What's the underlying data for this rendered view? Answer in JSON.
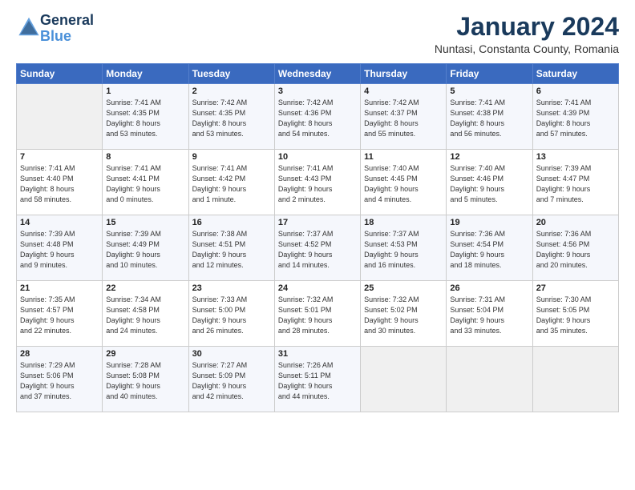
{
  "header": {
    "logo_line1": "General",
    "logo_line2": "Blue",
    "month": "January 2024",
    "location": "Nuntasi, Constanta County, Romania"
  },
  "days_of_week": [
    "Sunday",
    "Monday",
    "Tuesday",
    "Wednesday",
    "Thursday",
    "Friday",
    "Saturday"
  ],
  "weeks": [
    [
      {
        "day": "",
        "info": ""
      },
      {
        "day": "1",
        "info": "Sunrise: 7:41 AM\nSunset: 4:35 PM\nDaylight: 8 hours\nand 53 minutes."
      },
      {
        "day": "2",
        "info": "Sunrise: 7:42 AM\nSunset: 4:35 PM\nDaylight: 8 hours\nand 53 minutes."
      },
      {
        "day": "3",
        "info": "Sunrise: 7:42 AM\nSunset: 4:36 PM\nDaylight: 8 hours\nand 54 minutes."
      },
      {
        "day": "4",
        "info": "Sunrise: 7:42 AM\nSunset: 4:37 PM\nDaylight: 8 hours\nand 55 minutes."
      },
      {
        "day": "5",
        "info": "Sunrise: 7:41 AM\nSunset: 4:38 PM\nDaylight: 8 hours\nand 56 minutes."
      },
      {
        "day": "6",
        "info": "Sunrise: 7:41 AM\nSunset: 4:39 PM\nDaylight: 8 hours\nand 57 minutes."
      }
    ],
    [
      {
        "day": "7",
        "info": "Sunrise: 7:41 AM\nSunset: 4:40 PM\nDaylight: 8 hours\nand 58 minutes."
      },
      {
        "day": "8",
        "info": "Sunrise: 7:41 AM\nSunset: 4:41 PM\nDaylight: 9 hours\nand 0 minutes."
      },
      {
        "day": "9",
        "info": "Sunrise: 7:41 AM\nSunset: 4:42 PM\nDaylight: 9 hours\nand 1 minute."
      },
      {
        "day": "10",
        "info": "Sunrise: 7:41 AM\nSunset: 4:43 PM\nDaylight: 9 hours\nand 2 minutes."
      },
      {
        "day": "11",
        "info": "Sunrise: 7:40 AM\nSunset: 4:45 PM\nDaylight: 9 hours\nand 4 minutes."
      },
      {
        "day": "12",
        "info": "Sunrise: 7:40 AM\nSunset: 4:46 PM\nDaylight: 9 hours\nand 5 minutes."
      },
      {
        "day": "13",
        "info": "Sunrise: 7:39 AM\nSunset: 4:47 PM\nDaylight: 9 hours\nand 7 minutes."
      }
    ],
    [
      {
        "day": "14",
        "info": "Sunrise: 7:39 AM\nSunset: 4:48 PM\nDaylight: 9 hours\nand 9 minutes."
      },
      {
        "day": "15",
        "info": "Sunrise: 7:39 AM\nSunset: 4:49 PM\nDaylight: 9 hours\nand 10 minutes."
      },
      {
        "day": "16",
        "info": "Sunrise: 7:38 AM\nSunset: 4:51 PM\nDaylight: 9 hours\nand 12 minutes."
      },
      {
        "day": "17",
        "info": "Sunrise: 7:37 AM\nSunset: 4:52 PM\nDaylight: 9 hours\nand 14 minutes."
      },
      {
        "day": "18",
        "info": "Sunrise: 7:37 AM\nSunset: 4:53 PM\nDaylight: 9 hours\nand 16 minutes."
      },
      {
        "day": "19",
        "info": "Sunrise: 7:36 AM\nSunset: 4:54 PM\nDaylight: 9 hours\nand 18 minutes."
      },
      {
        "day": "20",
        "info": "Sunrise: 7:36 AM\nSunset: 4:56 PM\nDaylight: 9 hours\nand 20 minutes."
      }
    ],
    [
      {
        "day": "21",
        "info": "Sunrise: 7:35 AM\nSunset: 4:57 PM\nDaylight: 9 hours\nand 22 minutes."
      },
      {
        "day": "22",
        "info": "Sunrise: 7:34 AM\nSunset: 4:58 PM\nDaylight: 9 hours\nand 24 minutes."
      },
      {
        "day": "23",
        "info": "Sunrise: 7:33 AM\nSunset: 5:00 PM\nDaylight: 9 hours\nand 26 minutes."
      },
      {
        "day": "24",
        "info": "Sunrise: 7:32 AM\nSunset: 5:01 PM\nDaylight: 9 hours\nand 28 minutes."
      },
      {
        "day": "25",
        "info": "Sunrise: 7:32 AM\nSunset: 5:02 PM\nDaylight: 9 hours\nand 30 minutes."
      },
      {
        "day": "26",
        "info": "Sunrise: 7:31 AM\nSunset: 5:04 PM\nDaylight: 9 hours\nand 33 minutes."
      },
      {
        "day": "27",
        "info": "Sunrise: 7:30 AM\nSunset: 5:05 PM\nDaylight: 9 hours\nand 35 minutes."
      }
    ],
    [
      {
        "day": "28",
        "info": "Sunrise: 7:29 AM\nSunset: 5:06 PM\nDaylight: 9 hours\nand 37 minutes."
      },
      {
        "day": "29",
        "info": "Sunrise: 7:28 AM\nSunset: 5:08 PM\nDaylight: 9 hours\nand 40 minutes."
      },
      {
        "day": "30",
        "info": "Sunrise: 7:27 AM\nSunset: 5:09 PM\nDaylight: 9 hours\nand 42 minutes."
      },
      {
        "day": "31",
        "info": "Sunrise: 7:26 AM\nSunset: 5:11 PM\nDaylight: 9 hours\nand 44 minutes."
      },
      {
        "day": "",
        "info": ""
      },
      {
        "day": "",
        "info": ""
      },
      {
        "day": "",
        "info": ""
      }
    ]
  ]
}
